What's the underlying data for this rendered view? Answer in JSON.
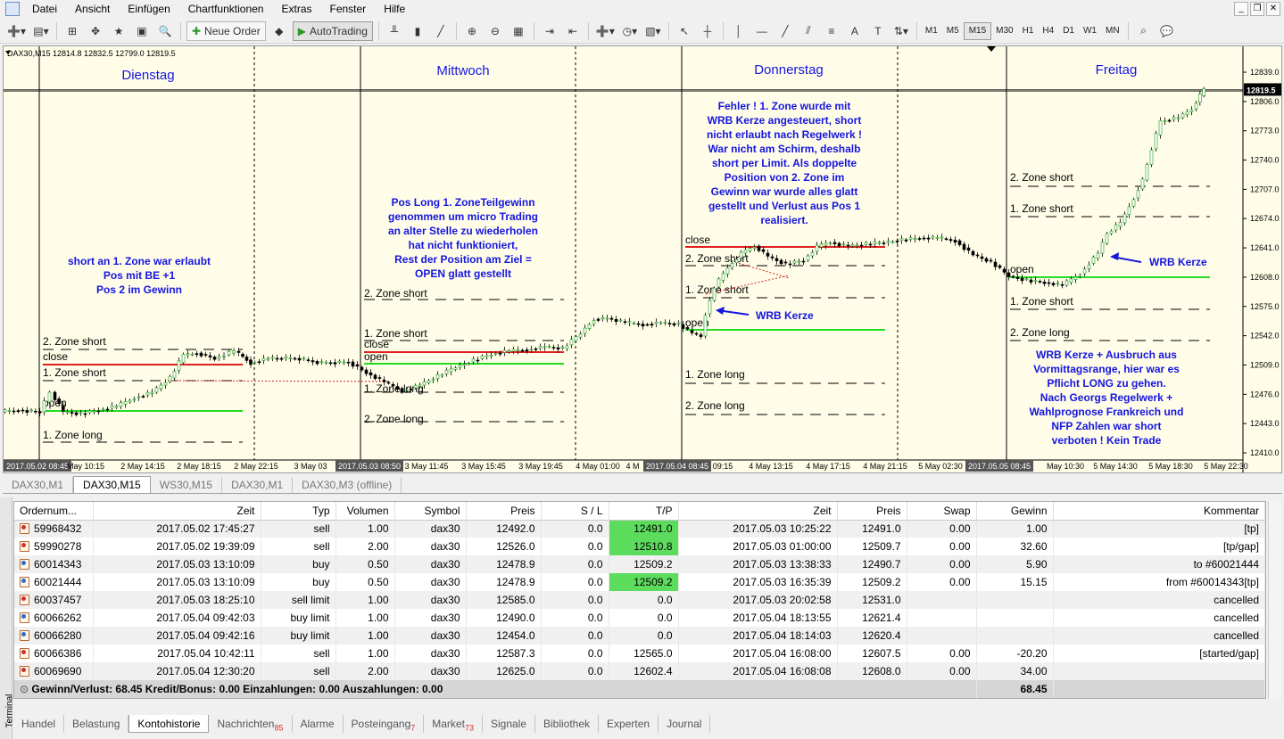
{
  "menu": [
    "Datei",
    "Ansicht",
    "Einfügen",
    "Chartfunktionen",
    "Extras",
    "Fenster",
    "Hilfe"
  ],
  "toolbar": {
    "neue_order": "Neue Order",
    "autotrading": "AutoTrading"
  },
  "timeframes": [
    "M1",
    "M5",
    "M15",
    "M30",
    "H1",
    "H4",
    "D1",
    "W1",
    "MN"
  ],
  "active_timeframe": "M15",
  "chart": {
    "info": "DAX30,M15  12814.8 12832.5 12799.0 12819.5",
    "current_price": "12819.5",
    "day_labels": [
      "Dienstag",
      "Mittwoch",
      "Donnerstag",
      "Freitag"
    ],
    "price_ticks": [
      "12839.0",
      "12806.0",
      "12773.0",
      "12740.0",
      "12707.0",
      "12674.0",
      "12641.0",
      "12608.0",
      "12575.0",
      "12542.0",
      "12509.0",
      "12476.0",
      "12443.0",
      "12410.0"
    ],
    "time_ticks": [
      "2017.05.02 08:45",
      "May 10:15",
      "2 May 14:15",
      "2 May 18:15",
      "2 May 22:15",
      "3 May 03",
      "2017.05.03 08:50",
      "3 May 11:45",
      "3 May 15:45",
      "3 May 19:45",
      "4 May 01:00",
      "4 M",
      "2017.05.04 08:45",
      "09:15",
      "4 May 13:15",
      "4 May 17:15",
      "4 May 21:15",
      "5 May 02:30",
      "2017.05.05 08:45",
      "May 10:30",
      "5 May 14:30",
      "5 May 18:30",
      "5 May 22:30"
    ],
    "zone_labels": {
      "d1": [
        "2. Zone short",
        "close",
        "1. Zone short",
        "open",
        "1. Zone long"
      ],
      "d2": [
        "2. Zone short",
        "1. Zone short",
        "close",
        "open",
        "1. Zone long",
        "2. Zone long"
      ],
      "d3": [
        "close",
        "2. Zone short",
        "1. Zone short",
        "open",
        "1. Zone long",
        "2. Zone long"
      ],
      "d4": [
        "2. Zone short",
        "1. Zone short",
        "open",
        "1. Zone short",
        "2. Zone long"
      ]
    },
    "notes": {
      "d1": [
        "short an 1. Zone war erlaubt",
        "Pos mit BE +1",
        "Pos 2 im Gewinn"
      ],
      "d2": [
        "Pos Long 1. ZoneTeilgewinn",
        "genommen um micro Trading",
        "an alter Stelle zu wiederholen",
        "hat nicht funktioniert,",
        "Rest der Position am Ziel =",
        "OPEN glatt gestellt"
      ],
      "d3": [
        "Fehler ! 1. Zone wurde mit",
        "WRB Kerze angesteuert, short",
        "nicht erlaubt nach Regelwerk !",
        "War nicht am Schirm, deshalb",
        "short per Limit.   Als doppelte",
        "Position von 2. Zone im",
        "Gewinn war wurde alles glatt",
        "gestellt und Verlust aus Pos 1",
        "realisiert."
      ],
      "d4": [
        "WRB Kerze + Ausbruch aus",
        "Vormittagsrange, hier war es",
        "Pflicht LONG zu gehen.",
        "Nach Georgs Regelwerk +",
        "Wahlprognose Frankreich und",
        "NFP Zahlen war short",
        "verboten ! Kein Trade"
      ]
    },
    "wrb_label": "WRB Kerze",
    "colors": {
      "bg": "#fffde8",
      "zone_red": "#e02020",
      "zone_green": "#22dd22",
      "note_blue": "#1515e0"
    }
  },
  "chart_tabs": [
    "DAX30,M1",
    "DAX30,M15",
    "WS30,M15",
    "DAX30,M1",
    "DAX30,M3 (offline)"
  ],
  "active_chart_tab": "DAX30,M15",
  "grid": {
    "headers": [
      "Ordernum...",
      "Zeit",
      "Typ",
      "Volumen",
      "Symbol",
      "Preis",
      "S / L",
      "T/P",
      "Zeit",
      "Preis",
      "Swap",
      "Gewinn",
      "Kommentar"
    ],
    "rows": [
      {
        "order": "59968432",
        "time": "2017.05.02 17:45:27",
        "type": "sell",
        "vol": "1.00",
        "sym": "dax30",
        "price": "12492.0",
        "sl": "0.0",
        "tp": "12491.0",
        "ctime": "2017.05.03 10:25:22",
        "cprice": "12491.0",
        "swap": "0.00",
        "profit": "1.00",
        "comment": "[tp]",
        "tp_hit": true,
        "side": "s"
      },
      {
        "order": "59990278",
        "time": "2017.05.02 19:39:09",
        "type": "sell",
        "vol": "2.00",
        "sym": "dax30",
        "price": "12526.0",
        "sl": "0.0",
        "tp": "12510.8",
        "ctime": "2017.05.03 01:00:00",
        "cprice": "12509.7",
        "swap": "0.00",
        "profit": "32.60",
        "comment": "[tp/gap]",
        "tp_hit": true,
        "side": "s"
      },
      {
        "order": "60014343",
        "time": "2017.05.03 13:10:09",
        "type": "buy",
        "vol": "0.50",
        "sym": "dax30",
        "price": "12478.9",
        "sl": "0.0",
        "tp": "12509.2",
        "ctime": "2017.05.03 13:38:33",
        "cprice": "12490.7",
        "swap": "0.00",
        "profit": "5.90",
        "comment": "to #60021444",
        "tp_hit": false,
        "side": "b"
      },
      {
        "order": "60021444",
        "time": "2017.05.03 13:10:09",
        "type": "buy",
        "vol": "0.50",
        "sym": "dax30",
        "price": "12478.9",
        "sl": "0.0",
        "tp": "12509.2",
        "ctime": "2017.05.03 16:35:39",
        "cprice": "12509.2",
        "swap": "0.00",
        "profit": "15.15",
        "comment": "from #60014343[tp]",
        "tp_hit": true,
        "side": "b"
      },
      {
        "order": "60037457",
        "time": "2017.05.03 18:25:10",
        "type": "sell limit",
        "vol": "1.00",
        "sym": "dax30",
        "price": "12585.0",
        "sl": "0.0",
        "tp": "0.0",
        "ctime": "2017.05.03 20:02:58",
        "cprice": "12531.0",
        "swap": "",
        "profit": "",
        "comment": "cancelled",
        "tp_hit": false,
        "side": "s"
      },
      {
        "order": "60066262",
        "time": "2017.05.04 09:42:03",
        "type": "buy limit",
        "vol": "1.00",
        "sym": "dax30",
        "price": "12490.0",
        "sl": "0.0",
        "tp": "0.0",
        "ctime": "2017.05.04 18:13:55",
        "cprice": "12621.4",
        "swap": "",
        "profit": "",
        "comment": "cancelled",
        "tp_hit": false,
        "side": "b"
      },
      {
        "order": "60066280",
        "time": "2017.05.04 09:42:16",
        "type": "buy limit",
        "vol": "1.00",
        "sym": "dax30",
        "price": "12454.0",
        "sl": "0.0",
        "tp": "0.0",
        "ctime": "2017.05.04 18:14:03",
        "cprice": "12620.4",
        "swap": "",
        "profit": "",
        "comment": "cancelled",
        "tp_hit": false,
        "side": "b"
      },
      {
        "order": "60066386",
        "time": "2017.05.04 10:42:11",
        "type": "sell",
        "vol": "1.00",
        "sym": "dax30",
        "price": "12587.3",
        "sl": "0.0",
        "tp": "12565.0",
        "ctime": "2017.05.04 16:08:00",
        "cprice": "12607.5",
        "swap": "0.00",
        "profit": "-20.20",
        "comment": "[started/gap]",
        "tp_hit": false,
        "side": "s"
      },
      {
        "order": "60069690",
        "time": "2017.05.04 12:30:20",
        "type": "sell",
        "vol": "2.00",
        "sym": "dax30",
        "price": "12625.0",
        "sl": "0.0",
        "tp": "12602.4",
        "ctime": "2017.05.04 16:08:08",
        "cprice": "12608.0",
        "swap": "0.00",
        "profit": "34.00",
        "comment": "",
        "tp_hit": false,
        "side": "s"
      }
    ],
    "summary": "Gewinn/Verlust: 68.45  Kredit/Bonus: 0.00  Einzahlungen: 0.00  Auszahlungen: 0.00",
    "summary_total": "68.45"
  },
  "terminal_label": "Terminal",
  "bottom_tabs": [
    {
      "label": "Handel",
      "badge": ""
    },
    {
      "label": "Belastung",
      "badge": ""
    },
    {
      "label": "Kontohistorie",
      "badge": ""
    },
    {
      "label": "Nachrichten",
      "badge": "85"
    },
    {
      "label": "Alarme",
      "badge": ""
    },
    {
      "label": "Posteingang",
      "badge": "7"
    },
    {
      "label": "Market",
      "badge": "73"
    },
    {
      "label": "Signale",
      "badge": ""
    },
    {
      "label": "Bibliothek",
      "badge": ""
    },
    {
      "label": "Experten",
      "badge": ""
    },
    {
      "label": "Journal",
      "badge": ""
    }
  ],
  "active_bottom_tab": "Kontohistorie"
}
